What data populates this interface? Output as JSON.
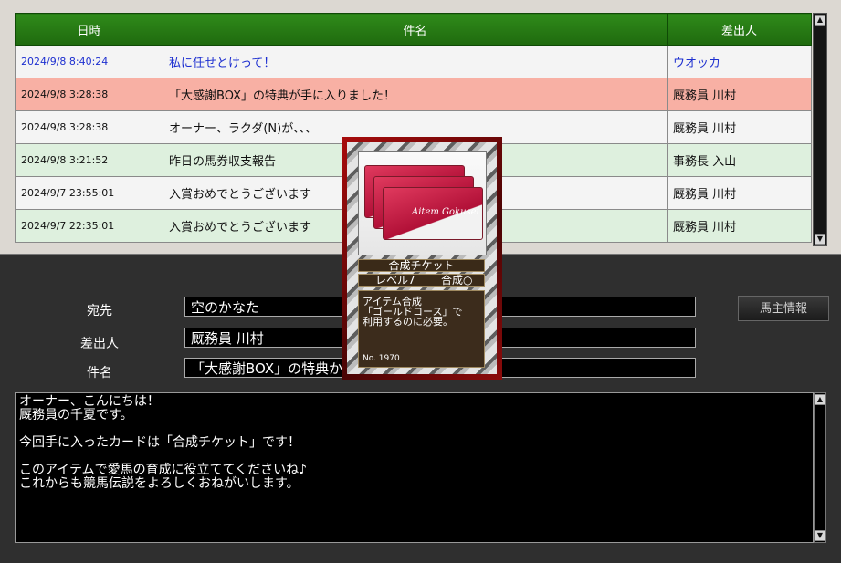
{
  "inbox": {
    "headers": {
      "date": "日時",
      "subject": "件名",
      "sender": "差出人"
    },
    "rows": [
      {
        "date": "2024/9/8 8:40:24",
        "subject": "私に任せとけって！",
        "sender": "ウオッカ"
      },
      {
        "date": "2024/9/8 3:28:38",
        "subject": "「大感謝BOX」の特典が手に入りました！",
        "sender": "厩務員 川村"
      },
      {
        "date": "2024/9/8 3:28:38",
        "subject": "オーナー、ラクダ(N)が、、、",
        "sender": "厩務員 川村"
      },
      {
        "date": "2024/9/8 3:21:52",
        "subject": "昨日の馬券収支報告",
        "sender": "事務長 入山"
      },
      {
        "date": "2024/9/7 23:55:01",
        "subject": "入賞おめでとうございます",
        "sender": "厩務員 川村"
      },
      {
        "date": "2024/9/7 22:35:01",
        "subject": "入賞おめでとうございます",
        "sender": "厩務員 川村"
      }
    ]
  },
  "form": {
    "to_label": "宛先",
    "to_value": "空のかなた",
    "from_label": "差出人",
    "from_value": "厩務員 川村",
    "subject_label": "件名",
    "subject_value": "「大感謝BOX」の特典か",
    "owner_button": "馬主情報"
  },
  "message_body": [
    "オーナー、こんにちは！",
    "厩務員の千夏です。",
    "",
    "今回手に入ったカードは「合成チケット」です！",
    "",
    "このアイテムで愛馬の育成に役立ててくださいね♪",
    "これからも競馬伝説をよろしくおねがいします。"
  ],
  "card": {
    "name": "合成チケット",
    "level": "レベル7",
    "synth": "合成○",
    "desc_lines": [
      "アイテム合成",
      "「ゴールドコース」で",
      "利用するのに必要。"
    ],
    "number": "No. 1970",
    "image_caption": "Aitem Gokusei"
  },
  "colors": {
    "header_green": "#1f6a0e",
    "row_pink": "#f8b0a4",
    "row_green": "#def0de",
    "link_blue": "#1d2fd0",
    "card_red": "#a80c0c"
  }
}
